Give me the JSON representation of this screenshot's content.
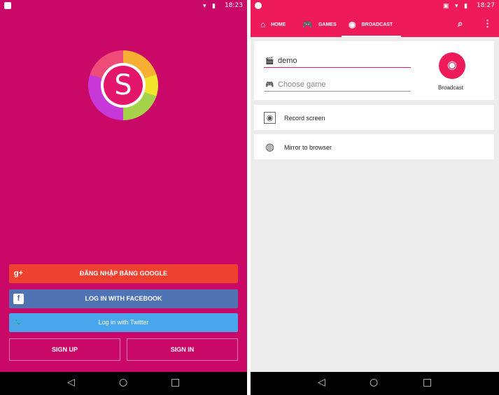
{
  "left": {
    "status_time": "18:23",
    "status_icons": "▾ ▮",
    "logo_letter": "S",
    "buttons": {
      "google": "ĐĂNG NHẬP BẰNG GOOGLE",
      "facebook": "LOG IN WITH FACEBOOK",
      "twitter": "Log in with Twitter",
      "sign_up": "SIGN UP",
      "sign_in": "SIGN IN"
    },
    "button_icons": {
      "google": "g+",
      "facebook": "f",
      "twitter": "🐦"
    },
    "colors": {
      "background": "#c90867",
      "google": "#ef4130",
      "facebook": "#4f73b3",
      "twitter": "#4aa6ec"
    }
  },
  "right": {
    "status_time": "18:27",
    "status_icons": "▣ ▾ ▮",
    "tabs": [
      {
        "label": "HOME",
        "icon": "⌂"
      },
      {
        "label": "GAMES",
        "icon": "🎮"
      },
      {
        "label": "BROADCAST",
        "icon": "◉"
      }
    ],
    "active_tab": "BROADCAST",
    "search_icon": "⌕",
    "menu_icon": "⋮",
    "title_field": {
      "value": "demo",
      "icon": "🎬"
    },
    "game_field": {
      "placeholder": "Choose game",
      "icon": "🎮"
    },
    "broadcast_label": "Broadcast",
    "record_screen": "Record screen",
    "mirror_to_browser": "Mirror to browser",
    "colors": {
      "accent": "#ef1a5a",
      "background": "#ececec"
    }
  },
  "nav": {
    "back": "◁",
    "home": "○",
    "recent": "□"
  }
}
